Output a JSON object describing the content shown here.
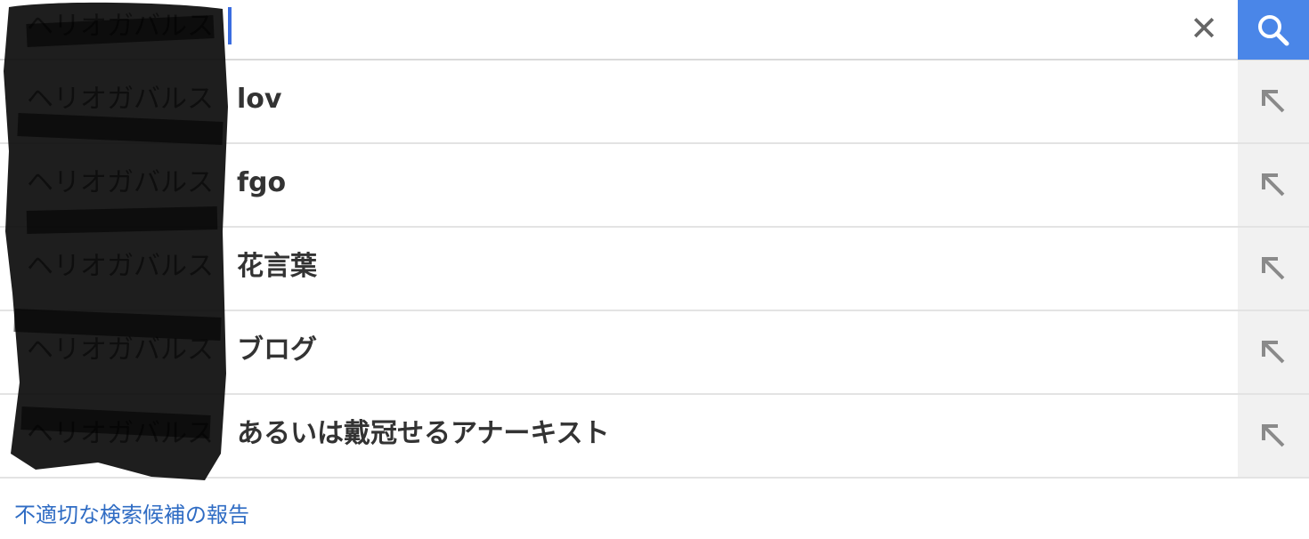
{
  "search": {
    "query": "ヘリオガバルス",
    "clear_icon": "close-icon",
    "search_icon": "search-icon"
  },
  "suggestions": [
    {
      "prefix": "ヘリオガバルス",
      "completion": "lov",
      "fill_icon": "arrow-up-left-icon"
    },
    {
      "prefix": "ヘリオガバルス",
      "completion": "fgo",
      "fill_icon": "arrow-up-left-icon"
    },
    {
      "prefix": "ヘリオガバルス",
      "completion": "花言葉",
      "fill_icon": "arrow-up-left-icon"
    },
    {
      "prefix": "ヘリオガバルス",
      "completion": "ブログ",
      "fill_icon": "arrow-up-left-icon"
    },
    {
      "prefix": "ヘリオガバルス",
      "completion": "あるいは戴冠せるアナーキスト",
      "fill_icon": "arrow-up-left-icon"
    }
  ],
  "footer": {
    "report_link": "不適切な検索候補の報告"
  },
  "colors": {
    "accent": "#4a86e8",
    "link": "#2f6cc4",
    "caret": "#3b6de0"
  }
}
